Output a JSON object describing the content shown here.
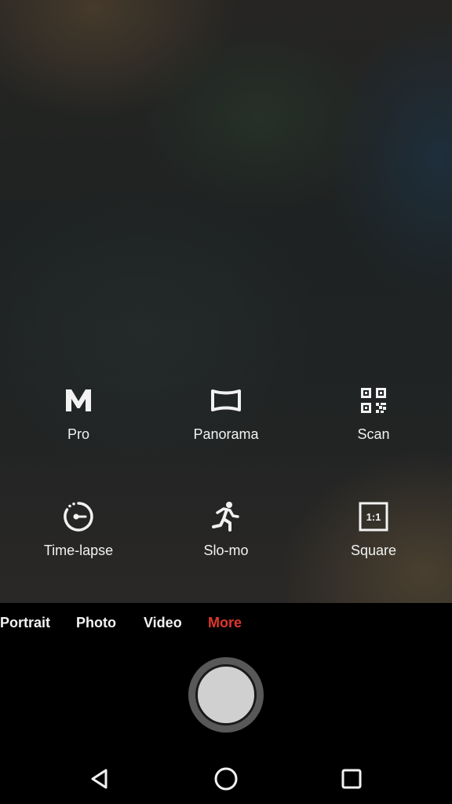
{
  "modes": [
    {
      "label": "Pro",
      "icon": "manual-m-icon"
    },
    {
      "label": "Panorama",
      "icon": "panorama-icon"
    },
    {
      "label": "Scan",
      "icon": "qr-code-icon"
    },
    {
      "label": "Time-lapse",
      "icon": "timelapse-dial-icon"
    },
    {
      "label": "Slo-mo",
      "icon": "running-person-icon"
    },
    {
      "label": "Square",
      "icon": "square-ratio-icon"
    }
  ],
  "square_icon_text": "1:1",
  "mode_bar": {
    "tabs": [
      "Portrait",
      "Photo",
      "Video",
      "More"
    ],
    "active_tab": "More"
  },
  "navigation": {
    "back": "back-triangle-icon",
    "home": "home-circle-icon",
    "recents": "recents-square-icon"
  },
  "colors": {
    "accent": "#e1362e",
    "text": "#f2f2f2",
    "panel": "#000000"
  }
}
